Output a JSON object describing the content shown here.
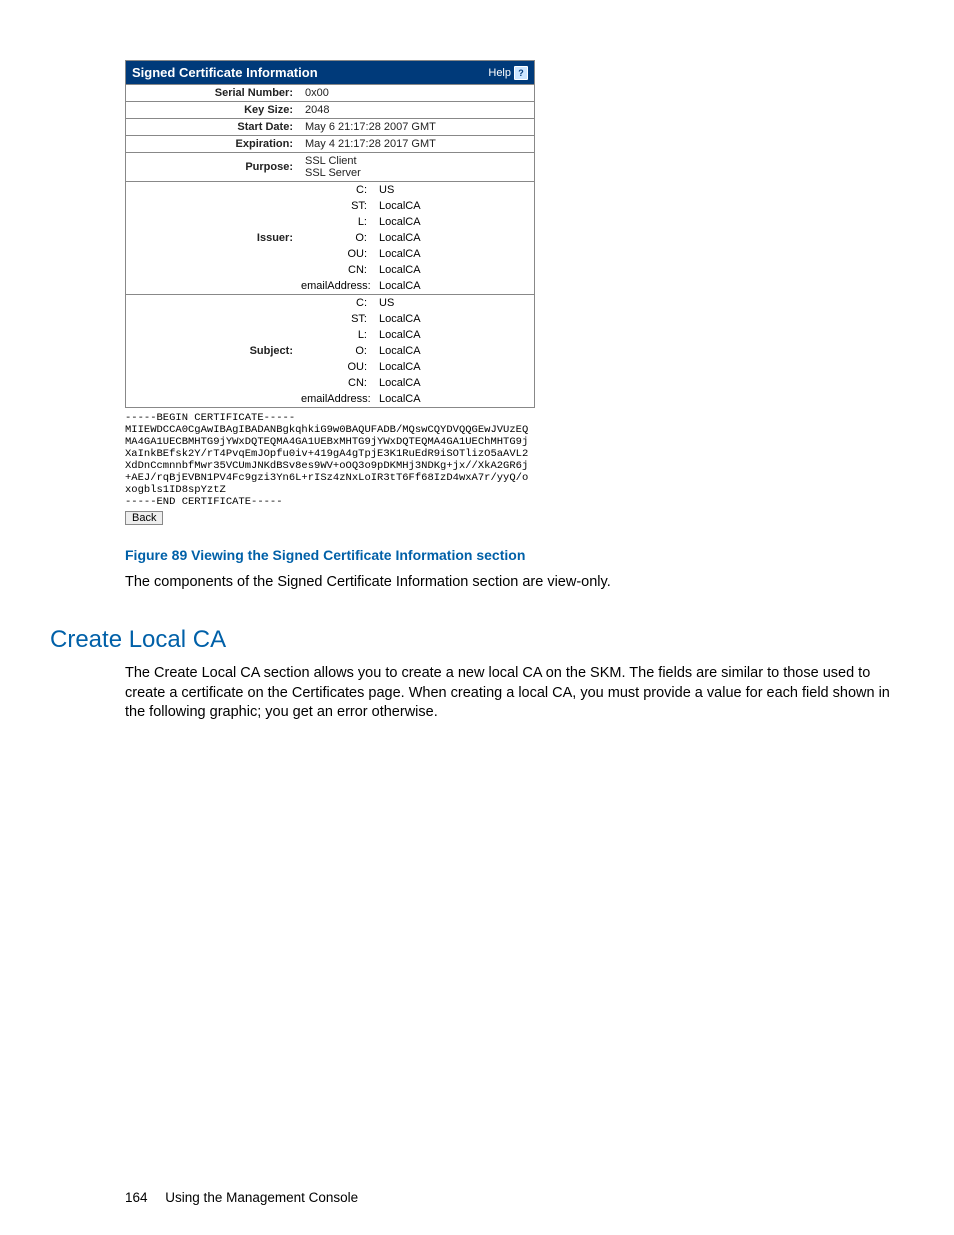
{
  "panel": {
    "title": "Signed Certificate Information",
    "help": "Help",
    "rows": {
      "serial_label": "Serial Number:",
      "serial_value": "0x00",
      "keysize_label": "Key Size:",
      "keysize_value": "2048",
      "start_label": "Start Date:",
      "start_value": "May  6 21:17:28 2007 GMT",
      "exp_label": "Expiration:",
      "exp_value": "May  4 21:17:28 2017 GMT",
      "purpose_label": "Purpose:",
      "purpose_value1": "SSL Client",
      "purpose_value2": "SSL Server",
      "issuer_label": "Issuer:",
      "subject_label": "Subject:"
    },
    "issuer": [
      {
        "k": "C:",
        "v": "US"
      },
      {
        "k": "ST:",
        "v": "LocalCA"
      },
      {
        "k": "L:",
        "v": "LocalCA"
      },
      {
        "k": "O:",
        "v": "LocalCA"
      },
      {
        "k": "OU:",
        "v": "LocalCA"
      },
      {
        "k": "CN:",
        "v": "LocalCA"
      },
      {
        "k": "emailAddress:",
        "v": "LocalCA"
      }
    ],
    "subject": [
      {
        "k": "C:",
        "v": "US"
      },
      {
        "k": "ST:",
        "v": "LocalCA"
      },
      {
        "k": "L:",
        "v": "LocalCA"
      },
      {
        "k": "O:",
        "v": "LocalCA"
      },
      {
        "k": "OU:",
        "v": "LocalCA"
      },
      {
        "k": "CN:",
        "v": "LocalCA"
      },
      {
        "k": "emailAddress:",
        "v": "LocalCA"
      }
    ]
  },
  "cert_pem": "-----BEGIN CERTIFICATE-----\nMIIEWDCCA0CgAwIBAgIBADANBgkqhkiG9w0BAQUFADB/MQswCQYDVQQGEwJVUzEQ\nMA4GA1UECBMHTG9jYWxDQTEQMA4GA1UEBxMHTG9jYWxDQTEQMA4GA1UEChMHTG9j\nXaInkBEfsk2Y/rT4PvqEmJOpfu0iv+419gA4gTpjE3K1RuEdR9iSOTlizO5aAVL2\nXdDnCcmnnbfMwr35VCUmJNKdBSv8es9WV+oOQ3o9pDKMHj3NDKg+jx//XkA2GR6j\n+AEJ/rqBjEVBN1PV4Fc9gzi3Yn6L+rISz4zNxLoIR3tT6Ff68IzD4wxA7r/yyQ/o\nxogbls1ID8spYztZ\n-----END CERTIFICATE-----",
  "back_btn": "Back",
  "figure_caption": "Figure 89 Viewing the Signed Certificate Information section",
  "body1": "The components of the Signed Certificate Information section are view-only.",
  "section_heading": "Create Local CA",
  "body2": "The Create Local CA section allows you to create a new local CA on the SKM. The fields are similar to those used to create a certificate on the Certificates page. When creating a local CA, you must provide a value for each field shown in the following graphic; you get an error otherwise.",
  "footer": {
    "page": "164",
    "title": "Using the Management Console"
  }
}
